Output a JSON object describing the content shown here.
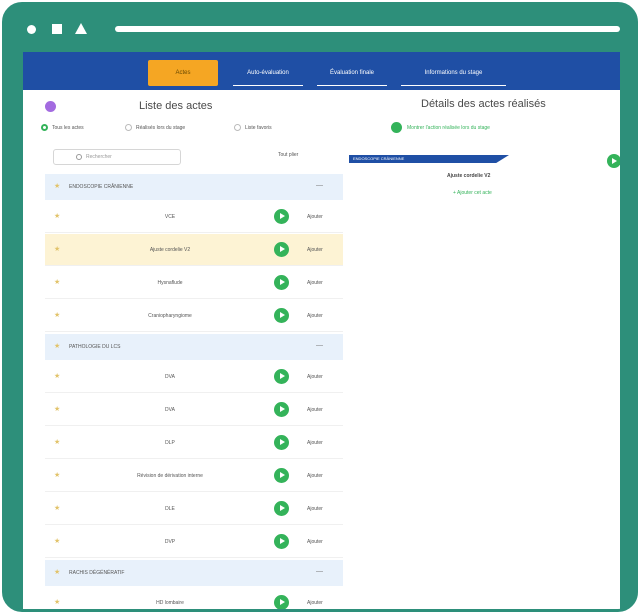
{
  "nav": {
    "tabs": [
      {
        "label": "Actes"
      },
      {
        "label": "Auto-évaluation"
      },
      {
        "label": "Évaluation finale"
      },
      {
        "label": "Informations du stage"
      }
    ]
  },
  "left": {
    "title": "Liste des actes",
    "filters": [
      {
        "label": "Tous les actes"
      },
      {
        "label": "Réalisés lors du stage"
      },
      {
        "label": "Liste favoris"
      }
    ],
    "search_placeholder": "Rechercher",
    "collapse_all": "Tout plier",
    "add_label": "Ajouter",
    "categories": [
      {
        "label": "ENDOSCOPIE CRÂNIENNE",
        "toggle": "—",
        "acts": [
          {
            "label": "VCE"
          },
          {
            "label": "Ajuste cordelie V2"
          },
          {
            "label": "Hysnaflude"
          },
          {
            "label": "Craniopharyngiome"
          }
        ]
      },
      {
        "label": "PATHOLOGIE DU LCS",
        "toggle": "—",
        "acts": [
          {
            "label": "DVA"
          },
          {
            "label": "DVA"
          },
          {
            "label": "DLP"
          },
          {
            "label": "Révision de dérivation interne"
          },
          {
            "label": "DLE"
          },
          {
            "label": "DVP"
          }
        ]
      },
      {
        "label": "RACHIS DÉGÉNÉRATIF",
        "toggle": "—",
        "acts": [
          {
            "label": "HD lombaire"
          }
        ]
      }
    ]
  },
  "right": {
    "title": "Détails des actes réalisés",
    "show_all": "Montrer l'action réalisée lors du stage",
    "banner": "ENDOSCOPIE CRÂNIENNE",
    "selected_act": "Ajuste cordelie V2",
    "add_act": "+ Ajouter cet acte"
  }
}
